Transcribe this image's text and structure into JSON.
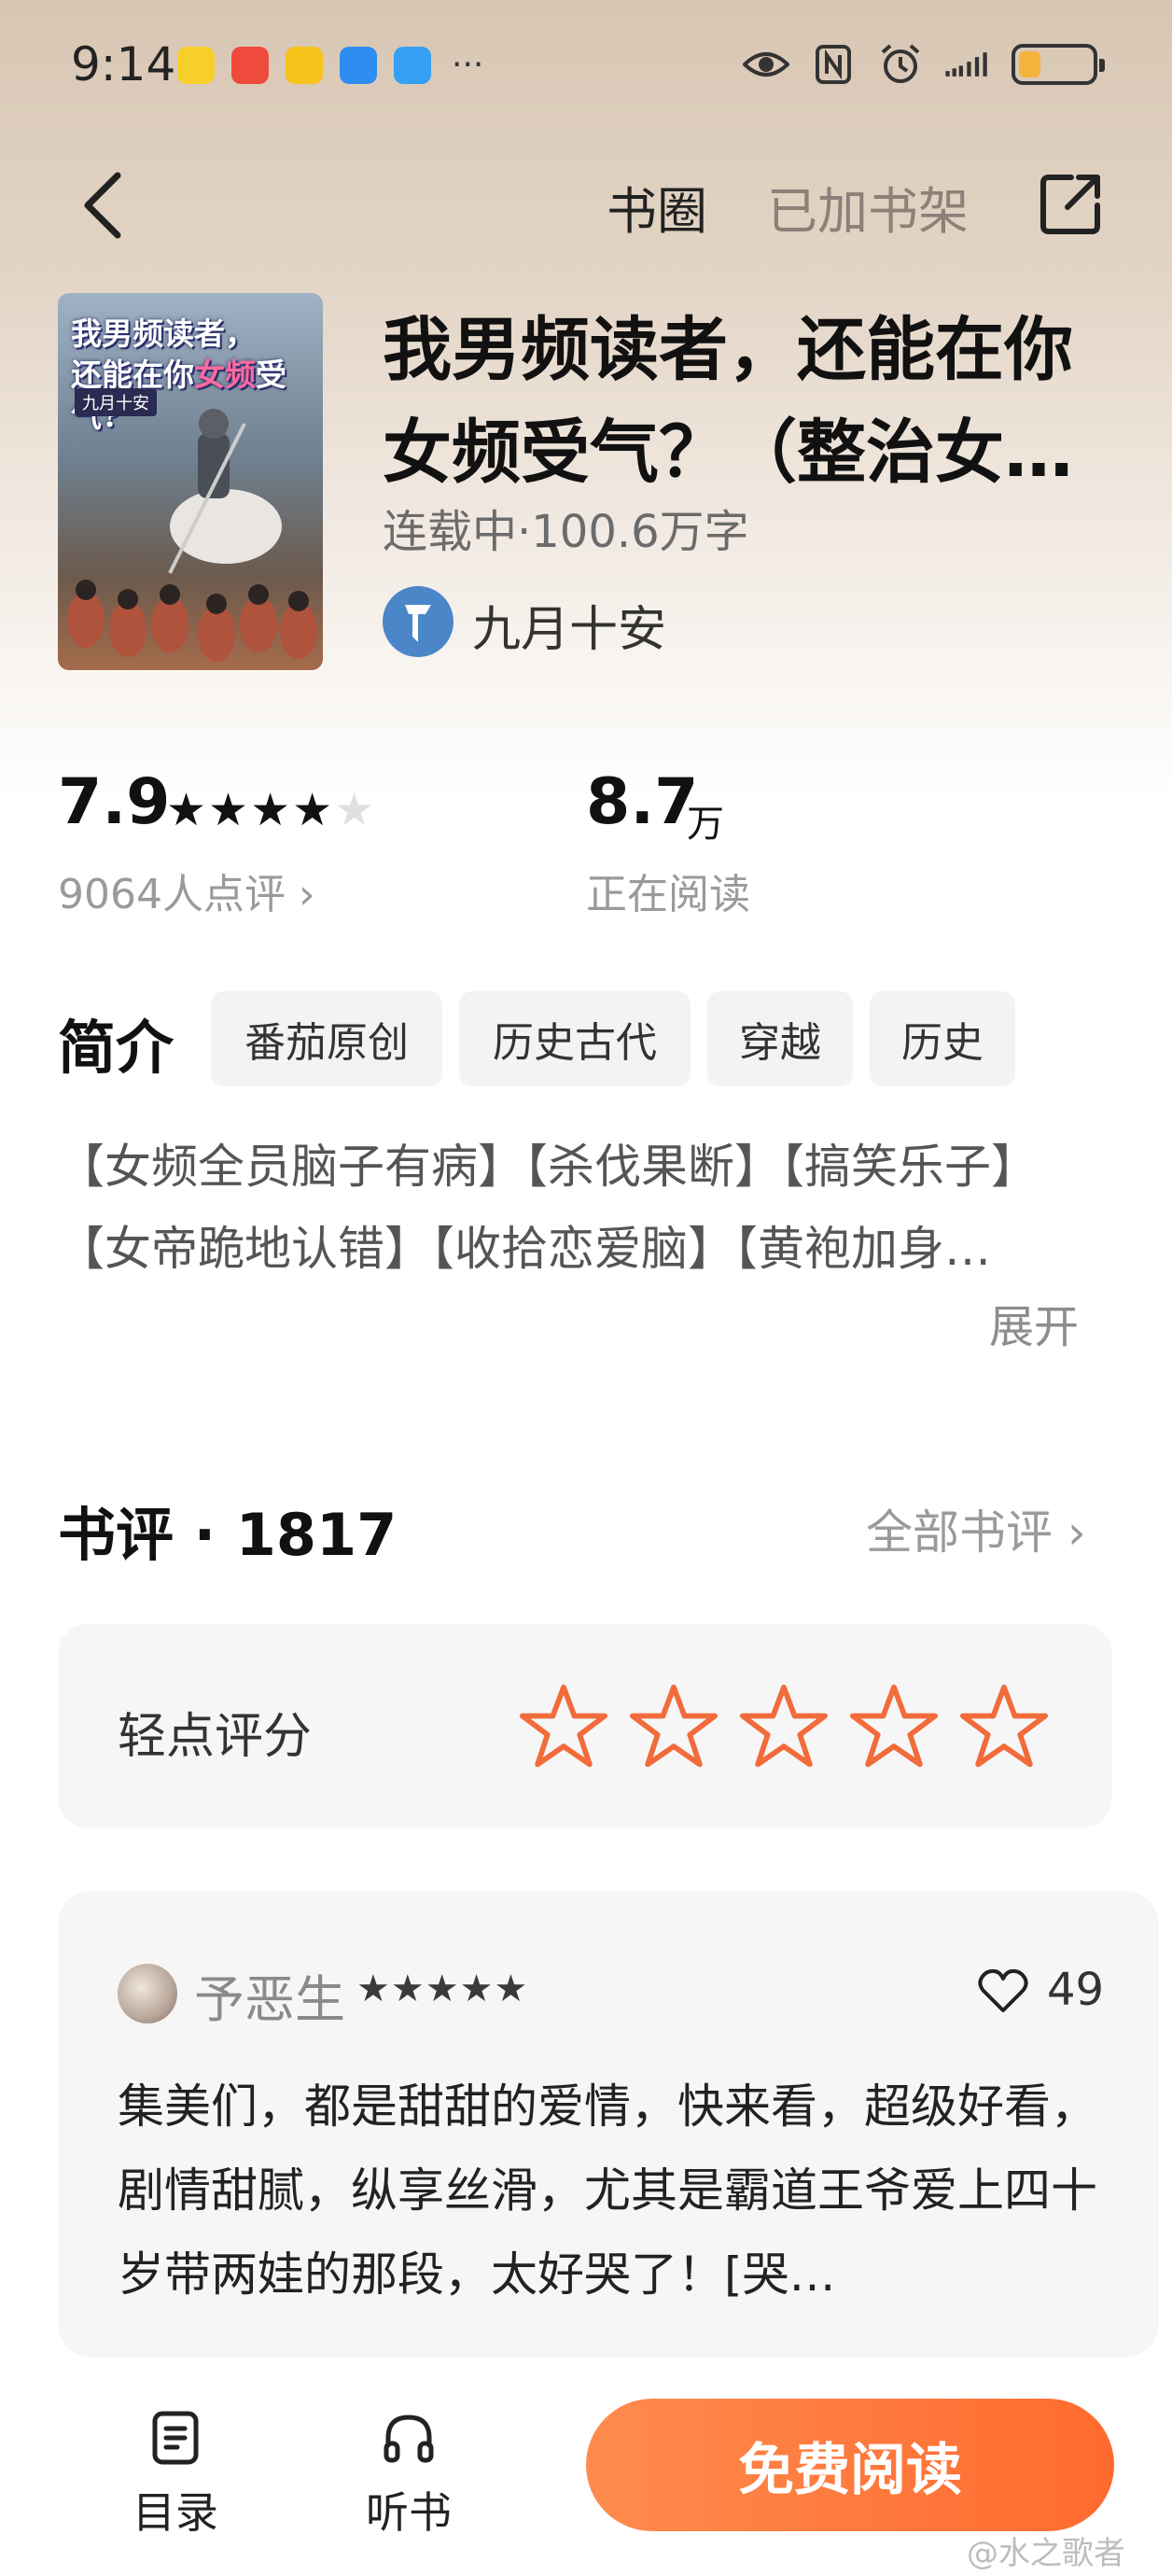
{
  "status_bar": {
    "time": "9:14",
    "more": "···",
    "app_colors": [
      "#f6cf2b",
      "#ef4b3c",
      "#f7c21a",
      "#2f8cf0",
      "#34a0f5"
    ]
  },
  "nav": {
    "book_circle": "书圈",
    "added_shelf": "已加书架"
  },
  "book": {
    "cover_title_line1": "我男频读者，",
    "cover_title_line2_a": "还能在你",
    "cover_title_line2_b": "女频",
    "cover_title_line2_c": "受气?",
    "cover_author": "九月十安",
    "title": "我男频读者，还能在你女频受气？（整治女…",
    "meta": "连载中·100.6万字",
    "author": "九月十安"
  },
  "stats": {
    "rating": "7.9",
    "stars_on": "★★★★",
    "stars_off": "★",
    "rating_count": "9064人点评 ›",
    "reading": "8.7",
    "reading_unit": "万",
    "reading_label": "正在阅读"
  },
  "intro": {
    "heading": "简介",
    "tags": [
      "番茄原创",
      "历史古代",
      "穿越",
      "历史"
    ],
    "text": "【女频全员脑子有病】【杀伐果断】【搞笑乐子】【女帝跪地认错】【收拾恋爱脑】【黄袍加身…",
    "expand": "展开"
  },
  "reviews": {
    "heading": "书评 · 1817",
    "all_link": "全部书评 ›",
    "rate_label": "轻点评分",
    "item": {
      "user": "予恶生",
      "stars": "★★★★★",
      "likes": "49",
      "text": "集美们，都是甜甜的爱情，快来看，超级好看，剧情甜腻，纵享丝滑，尤其是霸道王爷爱上四十岁带两娃的那段，太好哭了！[哭…"
    }
  },
  "bottom": {
    "toc": "目录",
    "listen": "听书",
    "read": "免费阅读"
  },
  "watermark": "@水之歌者",
  "colors": {
    "accent": "#ff6a2e",
    "star_outline": "#f26b3a"
  }
}
